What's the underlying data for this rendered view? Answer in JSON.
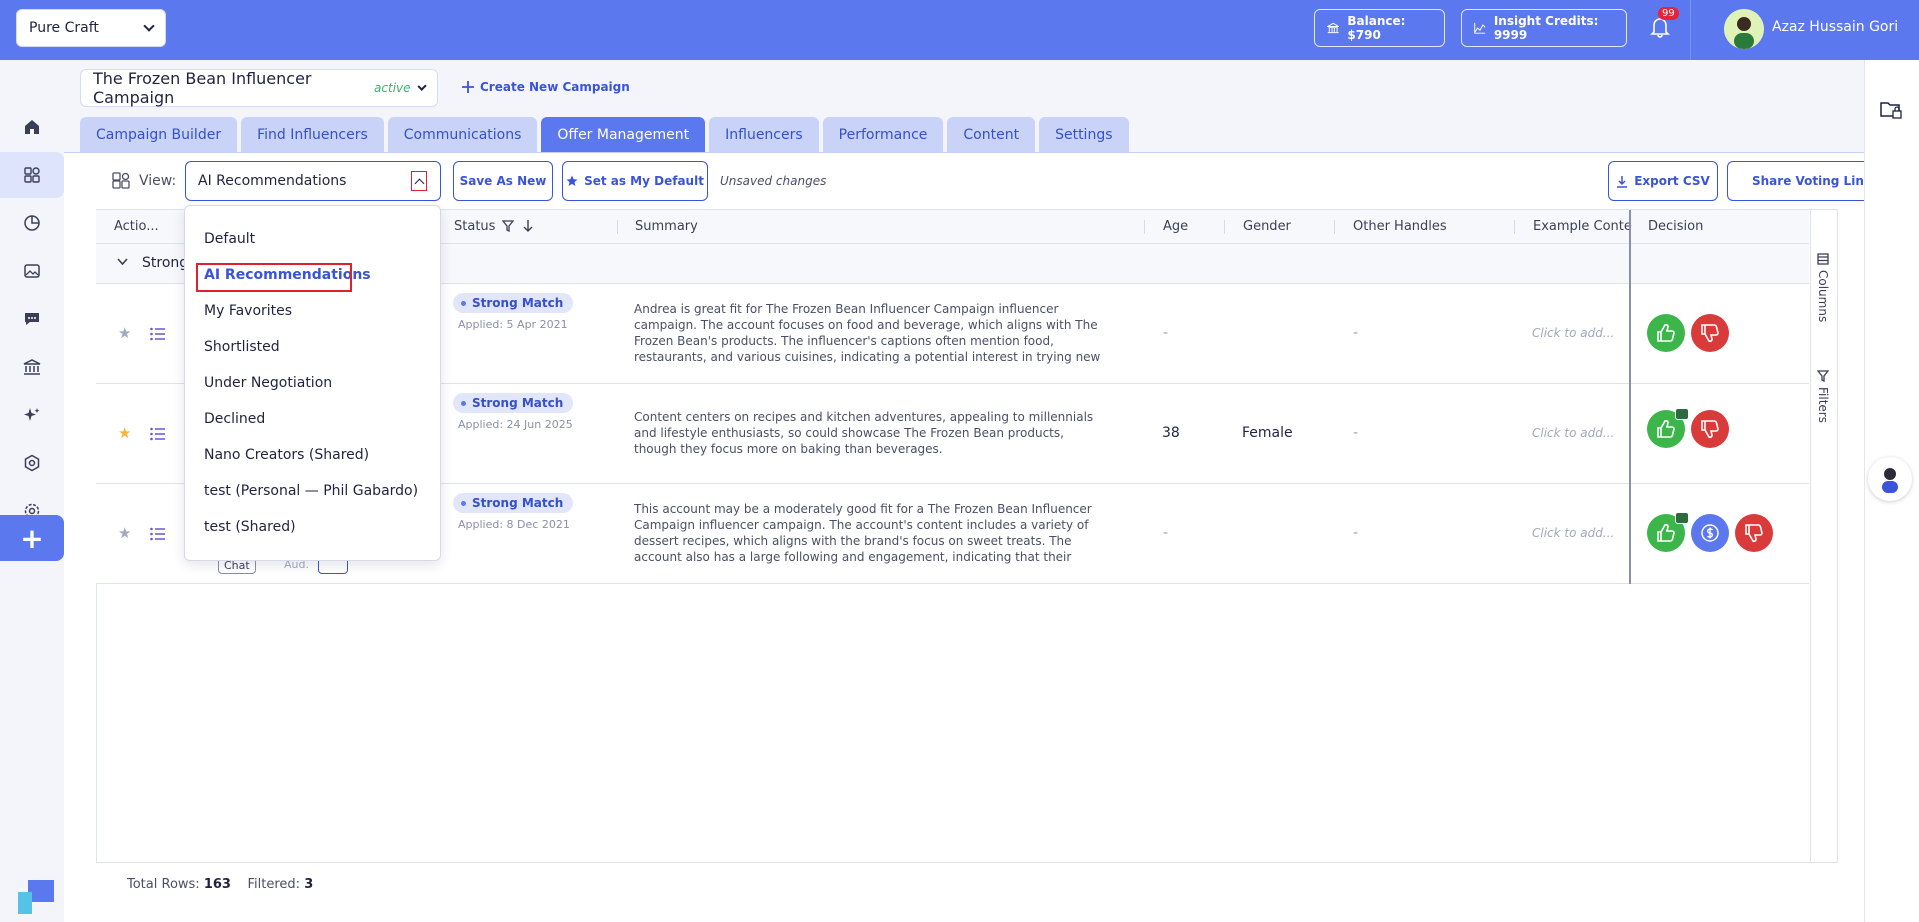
{
  "topbar": {
    "org_name": "Pure Craft",
    "balance": "Balance: $790",
    "insight_credits": "Insight Credits: 9999",
    "notification_count": "99",
    "user_name": "Azaz Hussain Gori"
  },
  "campaign": {
    "name": "The Frozen Bean Influencer Campaign",
    "status": "active",
    "create_new": "Create New Campaign"
  },
  "tabs": [
    {
      "label": "Campaign Builder"
    },
    {
      "label": "Find Influencers"
    },
    {
      "label": "Communications"
    },
    {
      "label": "Offer Management"
    },
    {
      "label": "Influencers"
    },
    {
      "label": "Performance"
    },
    {
      "label": "Content"
    },
    {
      "label": "Settings"
    }
  ],
  "toolbar": {
    "view_label": "View:",
    "view_value": "AI Recommendations",
    "save_as_new": "Save As New",
    "set_default": "Set as My Default",
    "unsaved": "Unsaved changes",
    "export_csv": "Export CSV",
    "share_voting": "Share Voting Link"
  },
  "dropdown": {
    "options": [
      "Default",
      "AI Recommendations",
      "My Favorites",
      "Shortlisted",
      "Under Negotiation",
      "Declined",
      "Nano Creators (Shared)",
      "test (Personal — Phil Gabardo)",
      "test (Shared)"
    ],
    "selected": "AI Recommendations"
  },
  "table": {
    "columns": {
      "actions": "Actio...",
      "status": "Status",
      "summary": "Summary",
      "age": "Age",
      "gender": "Gender",
      "other_handles": "Other Handles",
      "example_content": "Example Conte",
      "decision": "Decision"
    },
    "group_label": "Strong",
    "rows": [
      {
        "status": "Strong Match",
        "applied": "Applied: 5 Apr 2021",
        "summary": "Andrea is great fit for The Frozen Bean Influencer Campaign influencer campaign. The account focuses on food and beverage, which aligns with The Frozen Bean's products. The influencer's captions often mention food, restaurants, and various cuisines, indicating a potential interest in trying new and unique flavors.",
        "age": "-",
        "gender": "",
        "other_handles": "-",
        "example_content": "Click to add...",
        "starred": false
      },
      {
        "status": "Strong Match",
        "applied": "Applied: 24 Jun 2025",
        "summary": "Content centers on recipes and kitchen adventures, appealing to millennials and lifestyle enthusiasts, so could showcase The Frozen Bean products, though they focus more on baking than beverages.",
        "age": "38",
        "gender": "Female",
        "other_handles": "-",
        "example_content": "Click to add...",
        "starred": true
      },
      {
        "status": "Strong Match",
        "applied": "Applied: 8 Dec 2021",
        "summary": "This account may be a moderately good fit for a The Frozen Bean Influencer Campaign influencer campaign. The account's content includes a variety of dessert recipes, which aligns with the brand's focus on sweet treats. The account also has a large following and engagement, indicating that their audience is highly interested i...",
        "age": "-",
        "gender": "",
        "other_handles": "-",
        "example_content": "Click to add...",
        "starred": false
      }
    ],
    "row3_chat": "Chat",
    "row3_aud": "Aud."
  },
  "side_panel": {
    "columns": "Columns",
    "filters": "Filters"
  },
  "footer": {
    "total_label": "Total Rows:",
    "total": "163",
    "filtered_label": "Filtered:",
    "filtered": "3"
  },
  "colors": {
    "brand": "#5b78ee",
    "accent": "#3954d9",
    "approve": "#3cb54a",
    "reject": "#d93a3a",
    "highlight": "#e0202f"
  }
}
